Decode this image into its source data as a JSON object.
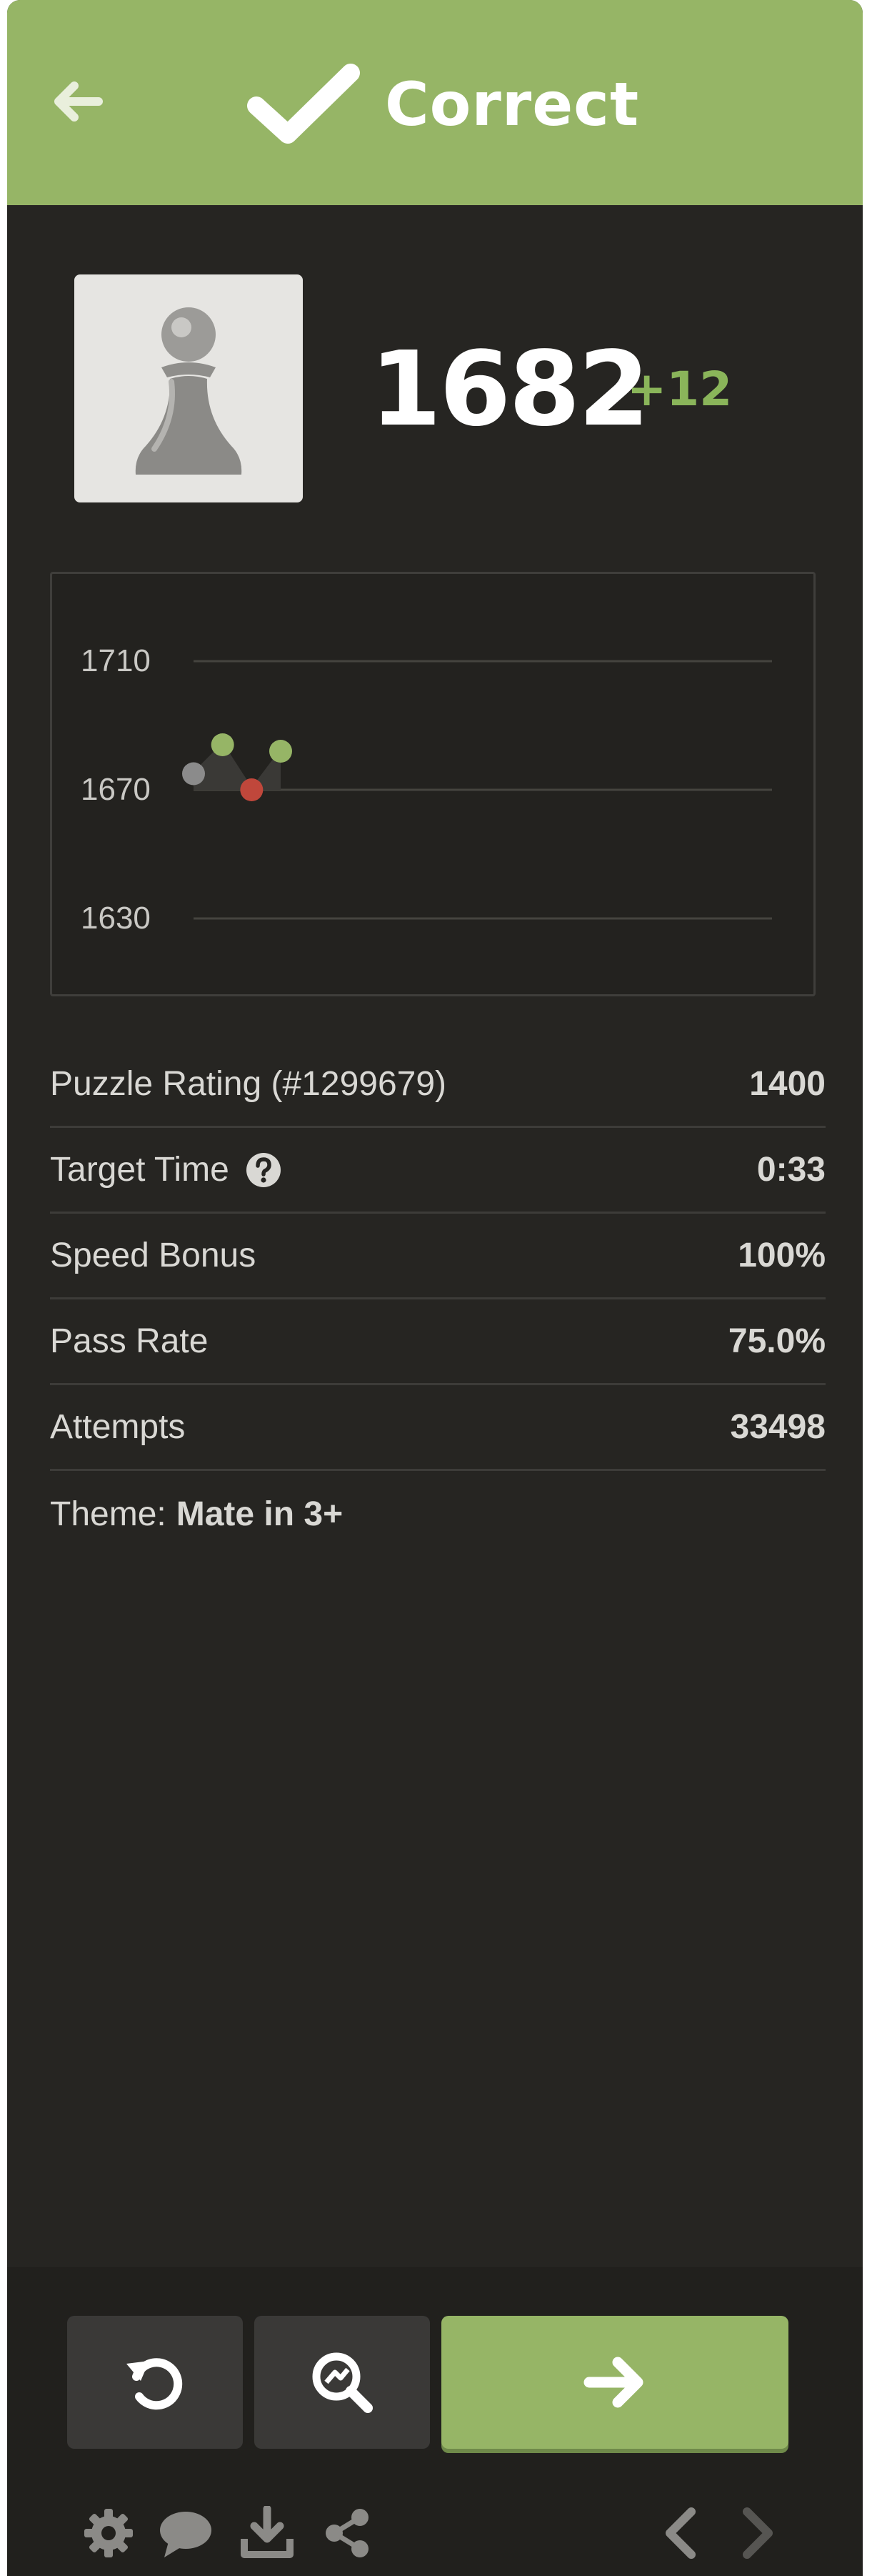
{
  "header": {
    "title": "Correct",
    "back_icon": "arrow-left-icon",
    "check_icon": "checkmark-icon"
  },
  "player": {
    "avatar_icon": "pawn-icon",
    "rating": "1682",
    "rating_delta": "+12"
  },
  "chart_data": {
    "type": "line",
    "title": "",
    "xlabel": "",
    "ylabel": "",
    "ylim": [
      1630,
      1710
    ],
    "yticks": [
      "1710",
      "1670",
      "1630"
    ],
    "x": [
      1,
      2,
      3,
      4
    ],
    "series": [
      {
        "values": [
          1675,
          1684,
          1670,
          1682
        ]
      }
    ],
    "point_colors": [
      "#8b8b8b",
      "#96b566",
      "#c0473b",
      "#96b566"
    ],
    "grid": true
  },
  "stats": [
    {
      "label": "Puzzle Rating (#1299679)",
      "value": "1400"
    },
    {
      "label": "Target Time",
      "value": "0:33",
      "help_icon": "question-circle-icon"
    },
    {
      "label": "Speed Bonus",
      "value": "100%"
    },
    {
      "label": "Pass Rate",
      "value": "75.0%"
    },
    {
      "label": "Attempts",
      "value": "33498"
    }
  ],
  "theme": {
    "prefix": "Theme:",
    "value": "Mate in 3+"
  },
  "actions": {
    "retry_icon": "retry-icon",
    "analyze_icon": "analysis-icon",
    "next_icon": "arrow-right-icon"
  },
  "toolbar": {
    "icons": [
      "gear-icon",
      "chat-icon",
      "download-icon",
      "share-icon",
      "chevron-left-icon",
      "chevron-right-icon"
    ]
  }
}
